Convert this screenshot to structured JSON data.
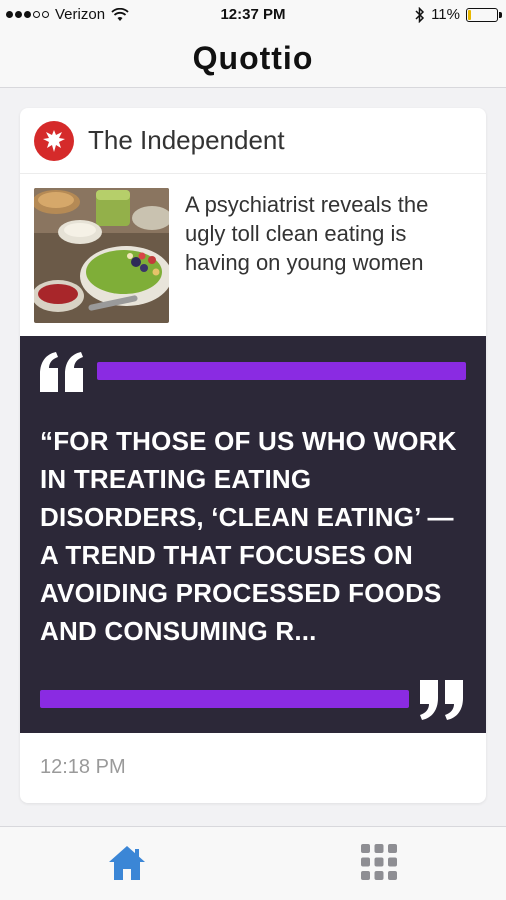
{
  "status_bar": {
    "carrier": "Verizon",
    "time": "12:37 PM",
    "battery_percent": "11%",
    "battery_level": 0.11,
    "signal_bars": 3,
    "signal_max": 5
  },
  "nav": {
    "title": "Quottio"
  },
  "card": {
    "source_name": "The Independent",
    "headline": "A psychiatrist reveals the ugly toll clean eating is having on young women",
    "quote": "“FOR THOSE OF US WHO WORK IN TREATING EATING DISORDERS, ‘CLEAN EATING’ — A TREND THAT FOCUSES ON AVOIDING PROCESSED FOODS AND CONSUMING R...",
    "timestamp": "12:18 PM"
  },
  "tab_bar": {
    "items": [
      {
        "icon": "home-icon",
        "selected": true
      },
      {
        "icon": "grid-icon",
        "selected": false
      }
    ]
  },
  "colors": {
    "accent": "#8a2be2",
    "quote_bg": "#2c2838",
    "tab_selected": "#3b86d6",
    "tab_unselected": "#8e8e93",
    "source_logo": "#d52a2a"
  }
}
